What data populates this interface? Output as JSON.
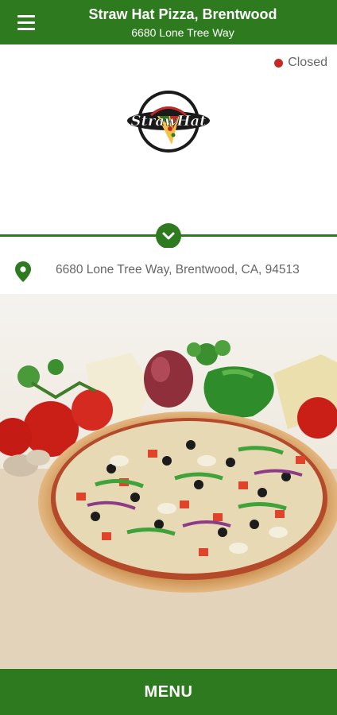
{
  "header": {
    "title": "Straw Hat Pizza, Brentwood",
    "subtitle": "6680 Lone Tree Way",
    "menu_icon": "hamburger-menu-icon"
  },
  "status": {
    "label": "Closed",
    "color": "#c62828"
  },
  "logo": {
    "text": "StrawHat",
    "icon": "straw-hat-logo"
  },
  "location": {
    "icon": "map-pin-icon",
    "address": "6680 Lone Tree Way, Brentwood, CA, 94513"
  },
  "hero_image": "veggie-pizza-photo",
  "footer": {
    "menu_label": "MENU"
  },
  "colors": {
    "brand_green": "#2d7a1f",
    "closed_red": "#c62828"
  }
}
